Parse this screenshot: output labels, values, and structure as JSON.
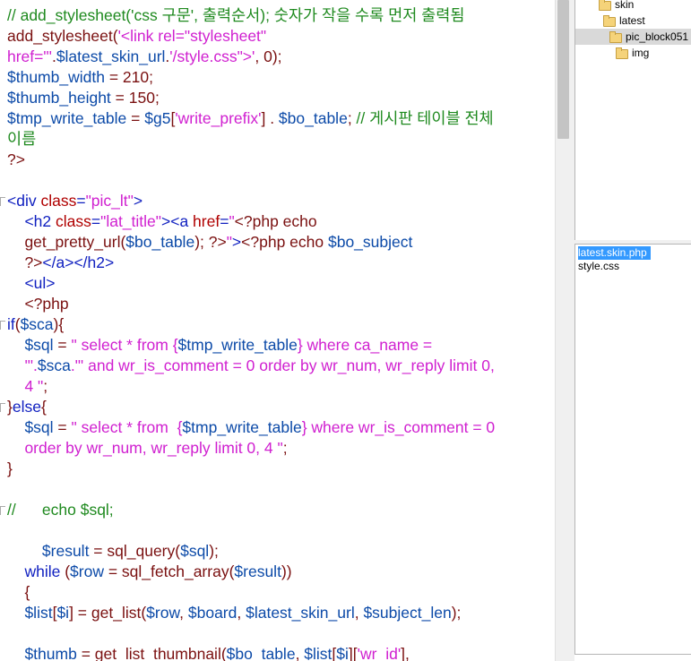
{
  "code_lines": [
    {
      "fold": false,
      "tokens": [
        [
          "cm",
          "// add_stylesheet('css 구문', 출력순서); 숫자가 작을 수록 먼저 출력됨"
        ]
      ]
    },
    {
      "fold": false,
      "tokens": [
        [
          "plain",
          "add_stylesheet("
        ],
        [
          "str",
          "'<link rel=\"stylesheet\""
        ]
      ]
    },
    {
      "fold": false,
      "tokens": [
        [
          "str",
          "href=\"'"
        ],
        [
          "plain",
          "."
        ],
        [
          "var",
          "$latest_skin_url"
        ],
        [
          "plain",
          "."
        ],
        [
          "str",
          "'/style.css\">'"
        ],
        [
          "plain",
          ", 0);"
        ]
      ]
    },
    {
      "fold": false,
      "tokens": [
        [
          "var",
          "$thumb_width"
        ],
        [
          "plain",
          " = 210;"
        ]
      ]
    },
    {
      "fold": false,
      "tokens": [
        [
          "var",
          "$thumb_height"
        ],
        [
          "plain",
          " = 150;"
        ]
      ]
    },
    {
      "fold": false,
      "tokens": [
        [
          "var",
          "$tmp_write_table"
        ],
        [
          "plain",
          " = "
        ],
        [
          "var",
          "$g5"
        ],
        [
          "plain",
          "["
        ],
        [
          "str",
          "'write_prefix'"
        ],
        [
          "plain",
          "] . "
        ],
        [
          "var",
          "$bo_table"
        ],
        [
          "plain",
          "; "
        ],
        [
          "cm",
          "// 게시판 테이블 전체"
        ]
      ]
    },
    {
      "fold": false,
      "tokens": [
        [
          "cm",
          "이름"
        ]
      ]
    },
    {
      "fold": false,
      "tokens": [
        [
          "plain",
          "?>"
        ]
      ]
    },
    {
      "fold": false,
      "tokens": []
    },
    {
      "fold": true,
      "tokens": [
        [
          "tag",
          "<div "
        ],
        [
          "attr",
          "class"
        ],
        [
          "tag",
          "="
        ],
        [
          "str",
          "\"pic_lt\""
        ],
        [
          "tag",
          ">"
        ]
      ]
    },
    {
      "fold": false,
      "tokens": [
        [
          "plain",
          "    "
        ],
        [
          "tag",
          "<h2 "
        ],
        [
          "attr",
          "class"
        ],
        [
          "tag",
          "="
        ],
        [
          "str",
          "\"lat_title\""
        ],
        [
          "tag",
          "><a "
        ],
        [
          "attr",
          "href"
        ],
        [
          "tag",
          "="
        ],
        [
          "str",
          "\""
        ],
        [
          "plain",
          "<?php echo"
        ]
      ]
    },
    {
      "fold": false,
      "tokens": [
        [
          "plain",
          "    get_pretty_url("
        ],
        [
          "var",
          "$bo_table"
        ],
        [
          "plain",
          "); ?>"
        ],
        [
          "str",
          "\""
        ],
        [
          "tag",
          ">"
        ],
        [
          "plain",
          "<?php echo "
        ],
        [
          "var",
          "$bo_subject"
        ]
      ]
    },
    {
      "fold": false,
      "tokens": [
        [
          "plain",
          "    ?>"
        ],
        [
          "tag",
          "</a></h2>"
        ]
      ]
    },
    {
      "fold": false,
      "tokens": [
        [
          "plain",
          "    "
        ],
        [
          "tag",
          "<ul>"
        ]
      ]
    },
    {
      "fold": false,
      "tokens": [
        [
          "plain",
          "    <?php"
        ]
      ]
    },
    {
      "fold": true,
      "tokens": [
        [
          "kw",
          "if"
        ],
        [
          "plain",
          "("
        ],
        [
          "var",
          "$sca"
        ],
        [
          "plain",
          "){"
        ]
      ]
    },
    {
      "fold": false,
      "tokens": [
        [
          "plain",
          "    "
        ],
        [
          "var",
          "$sql"
        ],
        [
          "plain",
          " = "
        ],
        [
          "str",
          "\" select * from {"
        ],
        [
          "var",
          "$tmp_write_table"
        ],
        [
          "str",
          "} where ca_name ="
        ]
      ]
    },
    {
      "fold": false,
      "tokens": [
        [
          "str",
          "    '\"."
        ],
        [
          "var",
          "$sca"
        ],
        [
          "str",
          ".\"' and wr_is_comment = 0 order by wr_num, wr_reply limit 0,"
        ]
      ]
    },
    {
      "fold": false,
      "tokens": [
        [
          "str",
          "    4 \""
        ],
        [
          "plain",
          ";"
        ]
      ]
    },
    {
      "fold": true,
      "tokens": [
        [
          "plain",
          "}"
        ],
        [
          "kw",
          "else"
        ],
        [
          "plain",
          "{"
        ]
      ]
    },
    {
      "fold": false,
      "tokens": [
        [
          "plain",
          "    "
        ],
        [
          "var",
          "$sql"
        ],
        [
          "plain",
          " = "
        ],
        [
          "str",
          "\" select * from  {"
        ],
        [
          "var",
          "$tmp_write_table"
        ],
        [
          "str",
          "} where wr_is_comment = 0"
        ]
      ]
    },
    {
      "fold": false,
      "tokens": [
        [
          "str",
          "    order by wr_num, wr_reply limit 0, 4 \""
        ],
        [
          "plain",
          ";"
        ]
      ]
    },
    {
      "fold": false,
      "tokens": [
        [
          "plain",
          "}"
        ]
      ]
    },
    {
      "fold": false,
      "tokens": []
    },
    {
      "fold": true,
      "tokens": [
        [
          "cm",
          "//      echo $sql;"
        ]
      ]
    },
    {
      "fold": false,
      "tokens": []
    },
    {
      "fold": false,
      "tokens": [
        [
          "plain",
          "        "
        ],
        [
          "var",
          "$result"
        ],
        [
          "plain",
          " = sql_query("
        ],
        [
          "var",
          "$sql"
        ],
        [
          "plain",
          ");"
        ]
      ]
    },
    {
      "fold": false,
      "tokens": [
        [
          "plain",
          "    "
        ],
        [
          "kw",
          "while"
        ],
        [
          "plain",
          " ("
        ],
        [
          "var",
          "$row"
        ],
        [
          "plain",
          " = sql_fetch_array("
        ],
        [
          "var",
          "$result"
        ],
        [
          "plain",
          "))"
        ]
      ]
    },
    {
      "fold": false,
      "tokens": [
        [
          "plain",
          "    {"
        ]
      ]
    },
    {
      "fold": false,
      "tokens": [
        [
          "plain",
          "    "
        ],
        [
          "var",
          "$list"
        ],
        [
          "plain",
          "["
        ],
        [
          "var",
          "$i"
        ],
        [
          "plain",
          "] = get_list("
        ],
        [
          "var",
          "$row"
        ],
        [
          "plain",
          ", "
        ],
        [
          "var",
          "$board"
        ],
        [
          "plain",
          ", "
        ],
        [
          "var",
          "$latest_skin_url"
        ],
        [
          "plain",
          ", "
        ],
        [
          "var",
          "$subject_len"
        ],
        [
          "plain",
          ");"
        ]
      ]
    },
    {
      "fold": false,
      "tokens": []
    },
    {
      "fold": false,
      "tokens": [
        [
          "plain",
          "    "
        ],
        [
          "var",
          "$thumb"
        ],
        [
          "plain",
          " = get_list_thumbnail("
        ],
        [
          "var",
          "$bo_table"
        ],
        [
          "plain",
          ", "
        ],
        [
          "var",
          "$list"
        ],
        [
          "plain",
          "["
        ],
        [
          "var",
          "$i"
        ],
        [
          "plain",
          "]["
        ],
        [
          "str",
          "'wr_id'"
        ],
        [
          "plain",
          "],"
        ]
      ]
    }
  ],
  "tree": {
    "items": [
      {
        "label": "skin",
        "indent": 1,
        "selected": false
      },
      {
        "label": "latest",
        "indent": 2,
        "selected": false
      },
      {
        "label": "pic_block051",
        "indent": 3,
        "selected": true
      },
      {
        "label": "img",
        "indent": 4,
        "selected": false
      }
    ]
  },
  "files": {
    "items": [
      {
        "label": "latest.skin.php",
        "selected": true
      },
      {
        "label": "style.css",
        "selected": false
      }
    ]
  }
}
